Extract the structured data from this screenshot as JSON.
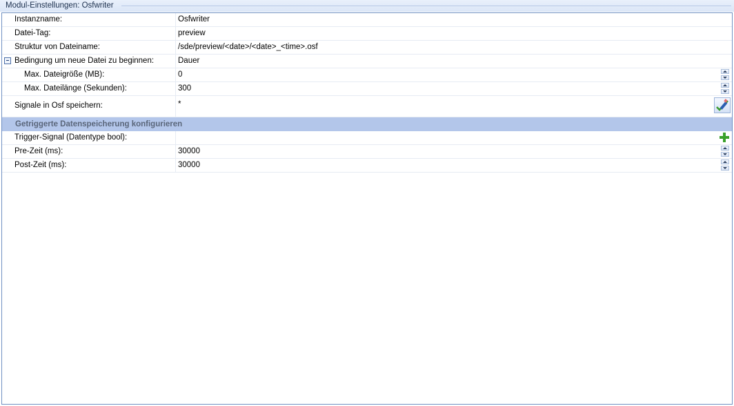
{
  "window": {
    "title": "Modul-Einstellungen: Osfwriter"
  },
  "properties": [
    {
      "label": "Instanzname:",
      "value": "Osfwriter"
    },
    {
      "label": "Datei-Tag:",
      "value": "preview"
    },
    {
      "label": "Struktur von Dateiname:",
      "value": "/sde/preview/<date>/<date>_<time>.osf"
    },
    {
      "label": "Bedingung um neue Datei zu beginnen:",
      "value": "Dauer"
    },
    {
      "label": "Max. Dateigröße (MB):",
      "value": "0"
    },
    {
      "label": "Max. Dateilänge (Sekunden):",
      "value": "300"
    },
    {
      "label": "Signale in Osf speichern:",
      "value": "*"
    }
  ],
  "trigger_section": {
    "title": "Getriggerte Datenspeicherung konfigurieren",
    "properties": [
      {
        "label": "Trigger-Signal (Datentype bool):",
        "value": ""
      },
      {
        "label": "Pre-Zeit (ms):",
        "value": "30000"
      },
      {
        "label": "Post-Zeit (ms):",
        "value": "30000"
      }
    ]
  },
  "colors": {
    "section_header_bg": "#b3c6ea",
    "grid_border": "#6f8fc2",
    "add_icon": "#3aa12b"
  },
  "icons": {
    "collapse": "minus-box-icon",
    "spinner": "up-down-arrow-icon",
    "edit": "pencil-check-icon",
    "add": "plus-icon"
  }
}
